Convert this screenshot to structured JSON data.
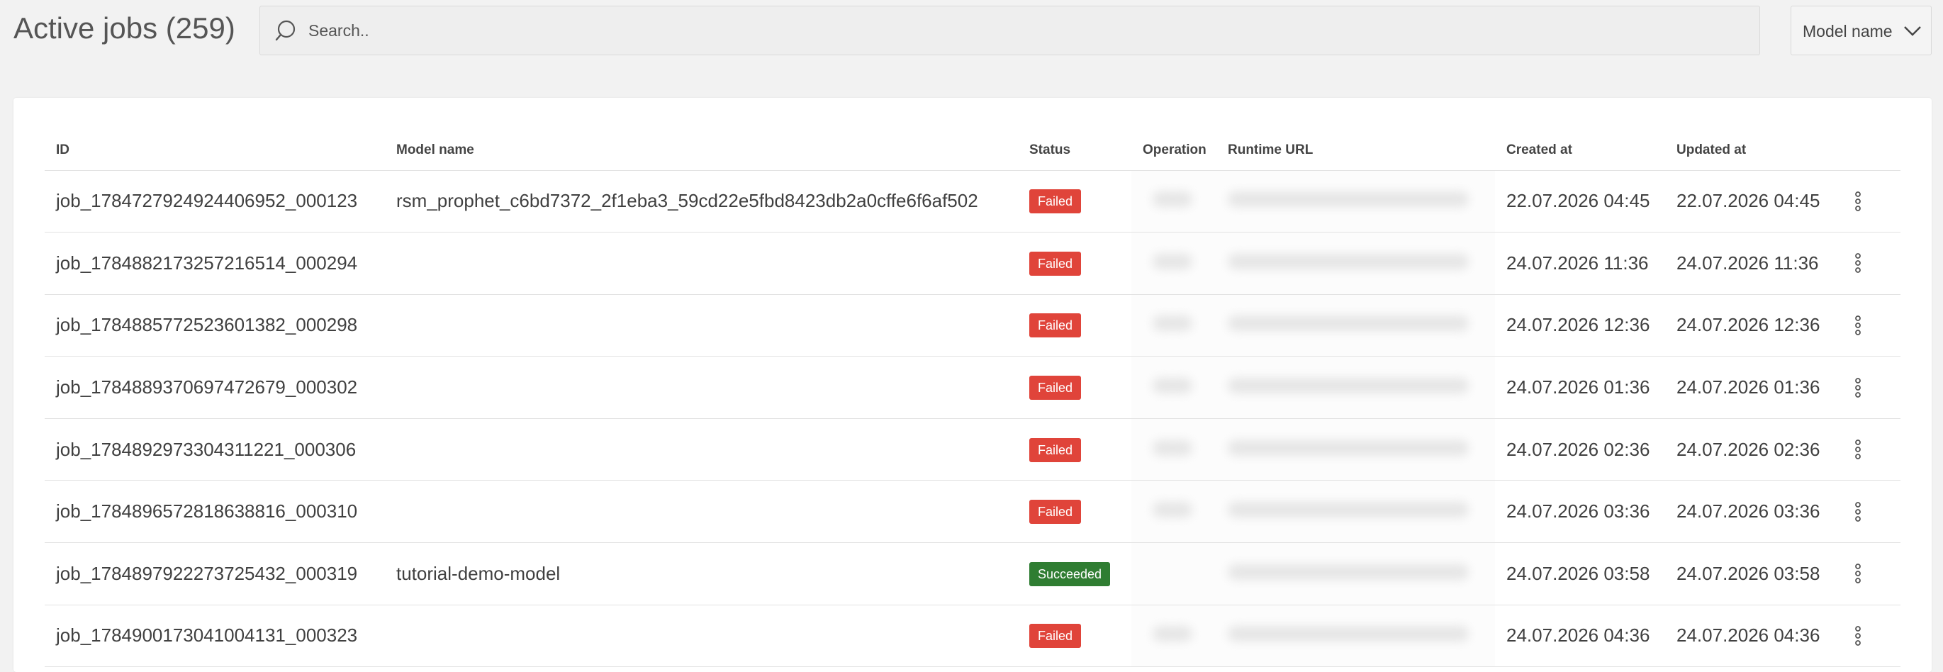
{
  "header": {
    "title": "Active jobs (259)",
    "search_placeholder": "Search..",
    "filter_label": "Model name"
  },
  "table": {
    "columns": [
      "ID",
      "Model name",
      "Status",
      "Operation",
      "Runtime URL",
      "Created at",
      "Updated at"
    ],
    "rows": [
      {
        "id": "job_1784727924924406952_000123",
        "model": "rsm_prophet_c6bd7372_2f1eba3_59cd22e5fbd8423db2a0cffe6f6af502",
        "status": "Failed",
        "created": "22.07.2026 04:45",
        "updated": "22.07.2026 04:45"
      },
      {
        "id": "job_1784882173257216514_000294",
        "model": "",
        "status": "Failed",
        "created": "24.07.2026 11:36",
        "updated": "24.07.2026 11:36"
      },
      {
        "id": "job_1784885772523601382_000298",
        "model": "",
        "status": "Failed",
        "created": "24.07.2026 12:36",
        "updated": "24.07.2026 12:36"
      },
      {
        "id": "job_1784889370697472679_000302",
        "model": "",
        "status": "Failed",
        "created": "24.07.2026 01:36",
        "updated": "24.07.2026 01:36"
      },
      {
        "id": "job_1784892973304311221_000306",
        "model": "",
        "status": "Failed",
        "created": "24.07.2026 02:36",
        "updated": "24.07.2026 02:36"
      },
      {
        "id": "job_1784896572818638816_000310",
        "model": "",
        "status": "Failed",
        "created": "24.07.2026 03:36",
        "updated": "24.07.2026 03:36"
      },
      {
        "id": "job_1784897922273725432_000319",
        "model": "tutorial-demo-model",
        "status": "Succeeded",
        "created": "24.07.2026 03:58",
        "updated": "24.07.2026 03:58"
      },
      {
        "id": "job_1784900173041004131_000323",
        "model": "",
        "status": "Failed",
        "created": "24.07.2026 04:36",
        "updated": "24.07.2026 04:36"
      }
    ]
  },
  "colors": {
    "failed": "#e0443a",
    "succeeded": "#2f7d32"
  },
  "icons": {
    "search": "search-icon",
    "dropdown": "chevron-down-icon",
    "row_menu": "kebab-menu-icon"
  }
}
